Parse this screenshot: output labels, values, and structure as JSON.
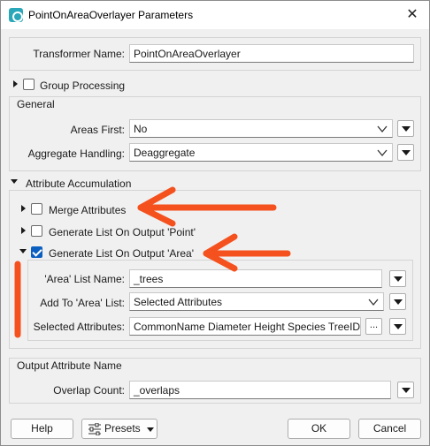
{
  "window": {
    "title": "PointOnAreaOverlayer Parameters",
    "close_glyph": "✕"
  },
  "transformer_name": {
    "label": "Transformer Name:",
    "value": "PointOnAreaOverlayer"
  },
  "group_processing": {
    "label": "Group Processing",
    "checked": false
  },
  "general": {
    "title": "General",
    "areas_first": {
      "label": "Areas First:",
      "value": "No"
    },
    "aggregate_handling": {
      "label": "Aggregate Handling:",
      "value": "Deaggregate"
    }
  },
  "attribute_accumulation": {
    "title": "Attribute Accumulation",
    "merge_attributes": {
      "label": "Merge Attributes",
      "checked": false
    },
    "list_point": {
      "label": "Generate List On Output 'Point'",
      "checked": false
    },
    "list_area": {
      "label": "Generate List On Output 'Area'",
      "checked": true,
      "list_name": {
        "label": "'Area' List Name:",
        "value": "_trees"
      },
      "add_to_list": {
        "label": "Add To 'Area' List:",
        "value": "Selected Attributes"
      },
      "selected_attributes": {
        "label": "Selected Attributes:",
        "value": "CommonName Diameter Height Species TreeID",
        "button": "..."
      }
    }
  },
  "output_attribute_name": {
    "title": "Output Attribute Name",
    "overlap_count": {
      "label": "Overlap Count:",
      "value": "_overlaps"
    }
  },
  "footer": {
    "help": "Help",
    "presets": "Presets",
    "ok": "OK",
    "cancel": "Cancel"
  },
  "colors": {
    "annotation": "#f4511e",
    "checkbox_checked": "#0b5fc0"
  },
  "icons": {
    "app": "transformer-app-icon",
    "close": "close-icon",
    "dropdown": "chevron-down-icon",
    "menu": "triangle-down-icon",
    "presets": "sliders-icon",
    "annotation": "arrow-left-icon"
  }
}
